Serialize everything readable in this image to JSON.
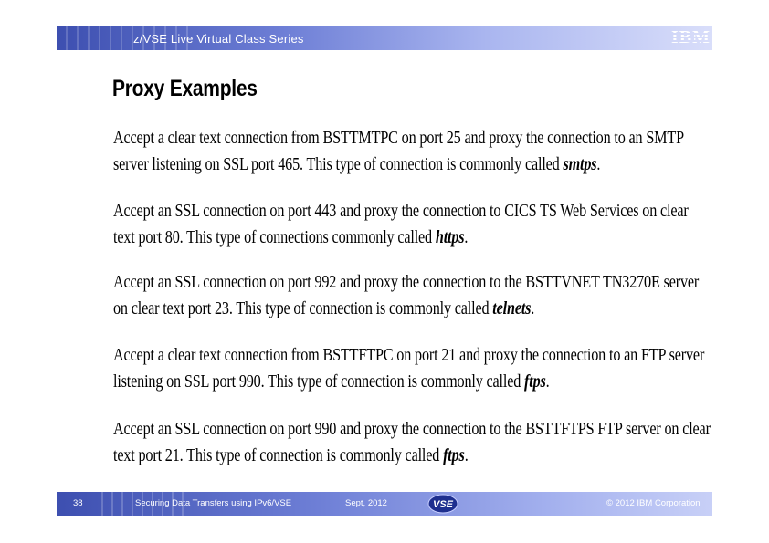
{
  "header": {
    "series": "z/VSE Live Virtual Class Series",
    "logo": "IBM"
  },
  "slide": {
    "title": "Proxy Examples",
    "paragraphs": [
      {
        "line1": "Accept a clear text connection from BSTTMTPC on port 25 and proxy the connection to an SMTP",
        "line2": "server listening on SSL port 465. This type of connection is commonly called ",
        "keyword": "smtps",
        "end": "."
      },
      {
        "line1": "Accept an SSL connection on port 443 and proxy the connection to CICS TS Web Services on clear",
        "line2": "text port 80. This type of connections commonly called ",
        "keyword": "https",
        "end": "."
      },
      {
        "line1": "Accept an SSL connection on port 992 and proxy the connection to the BSTTVNET TN3270E server",
        "line2": "on clear text port 23. This type of connection is commonly called ",
        "keyword": "telnets",
        "end": "."
      },
      {
        "line1": "Accept a clear text connection from BSTTFTPC on port 21 and proxy the connection to an FTP server",
        "line2": "listening on SSL port 990. This type of connection is commonly called ",
        "keyword": "ftps",
        "end": "."
      },
      {
        "line1": "Accept an SSL connection on port 990 and proxy the connection to the BSTTFTPS FTP server on clear",
        "line2": "text port 21. This type of connection is commonly called ",
        "keyword": "ftps",
        "end": "."
      }
    ]
  },
  "footer": {
    "page_number": "38",
    "session_title": "Securing Data Transfers using IPv6/VSE",
    "date": "Sept, 2012",
    "vse_logo": "VSE",
    "copyright": "© 2012 IBM Corporation"
  },
  "colors": {
    "band_dark": "#3d4fb0",
    "band_light": "#d9defa",
    "text": "#000000"
  }
}
